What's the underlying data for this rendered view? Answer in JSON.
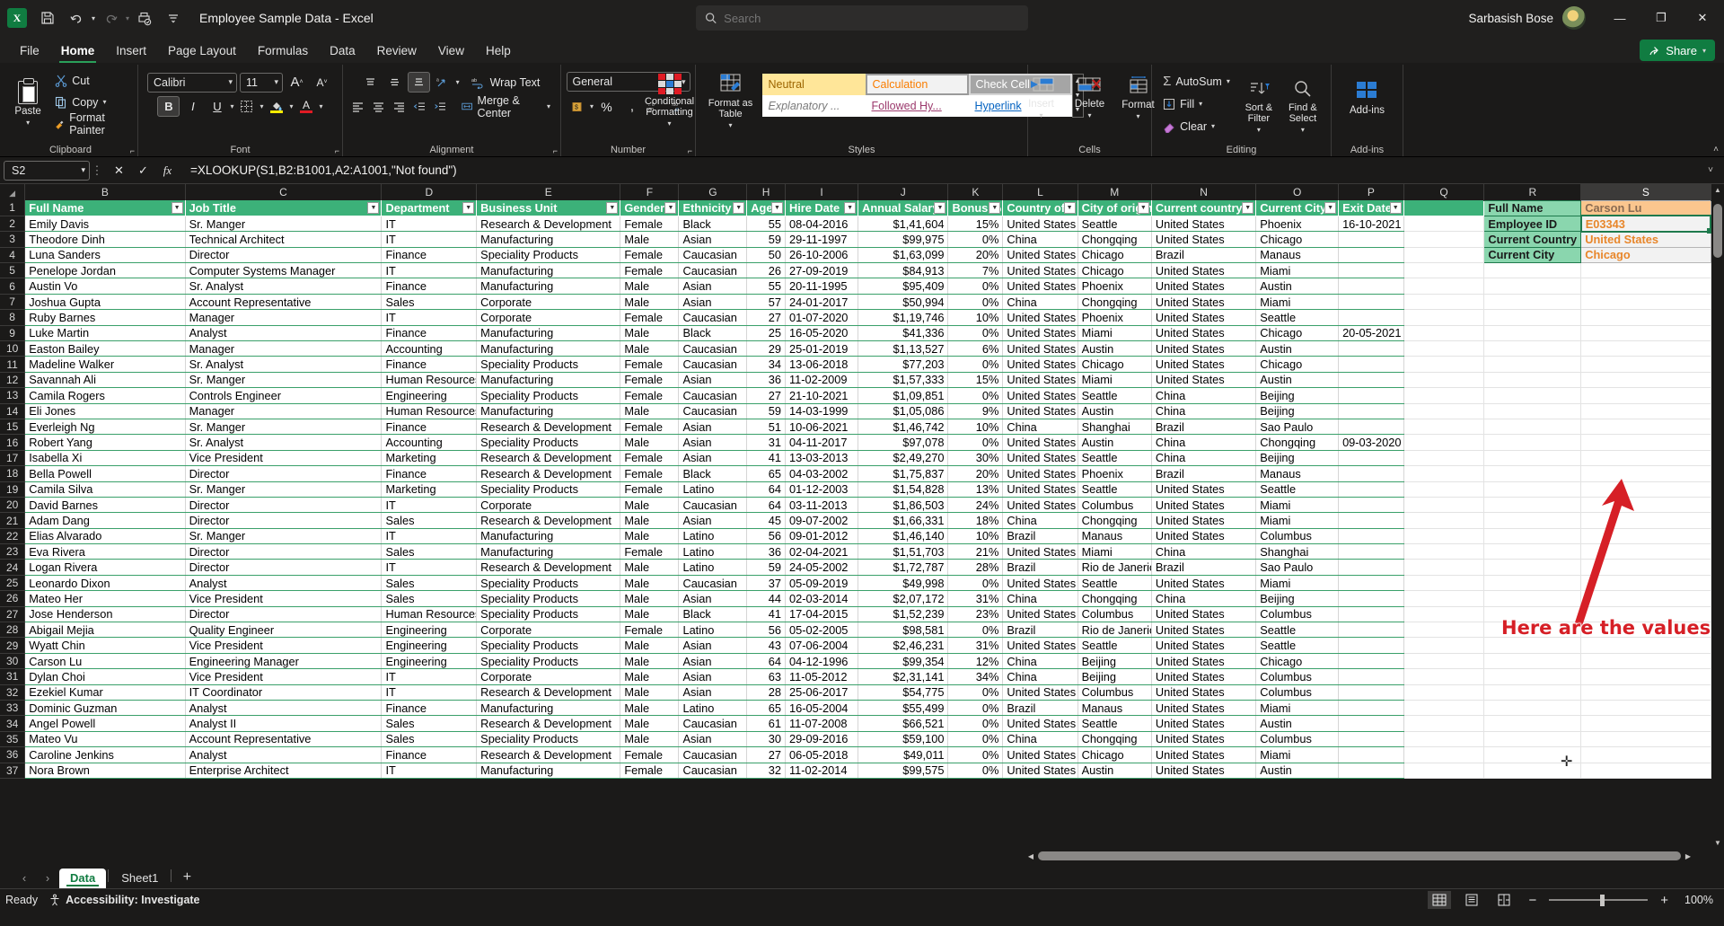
{
  "titlebar": {
    "app_icon": "excel-icon",
    "save_icon": "save-icon",
    "undo_icon": "undo-icon",
    "redo_icon": "redo-icon",
    "print_icon": "quick-print-icon",
    "customize_icon": "customize-qat-icon",
    "document_title": "Employee Sample Data  -  Excel",
    "search_placeholder": "Search",
    "user_name": "Sarbasish Bose",
    "minimize": "—",
    "restore": "❐",
    "close": "✕"
  },
  "ribbon_tabs": [
    {
      "label": "File",
      "active": false
    },
    {
      "label": "Home",
      "active": true
    },
    {
      "label": "Insert",
      "active": false
    },
    {
      "label": "Page Layout",
      "active": false
    },
    {
      "label": "Formulas",
      "active": false
    },
    {
      "label": "Data",
      "active": false
    },
    {
      "label": "Review",
      "active": false
    },
    {
      "label": "View",
      "active": false
    },
    {
      "label": "Help",
      "active": false
    }
  ],
  "share_button": "Share",
  "ribbon": {
    "clipboard": {
      "group_label": "Clipboard",
      "paste": "Paste",
      "cut": "Cut",
      "copy": "Copy",
      "format_painter": "Format Painter"
    },
    "font": {
      "group_label": "Font",
      "font_family": "Calibri",
      "font_size": "11",
      "grow_font": "A",
      "shrink_font": "A",
      "bold": "B",
      "italic": "I",
      "underline": "U",
      "borders": "borders-icon",
      "fill_color": "fill-color-icon",
      "font_color": "font-color-icon"
    },
    "alignment": {
      "group_label": "Alignment",
      "wrap_text": "Wrap Text",
      "merge_center": "Merge & Center",
      "orientation": "orientation-icon"
    },
    "number": {
      "group_label": "Number",
      "format": "General",
      "accounting": "accounting-format-icon",
      "percent": "%",
      "comma": " ,",
      "increase_decimal": ".00",
      "decrease_decimal": ".0"
    },
    "styles": {
      "group_label": "Styles",
      "conditional_formatting": "Conditional Formatting",
      "format_as_table": "Format as Table",
      "cell_styles": [
        {
          "label": "Neutral",
          "kind": "neutral"
        },
        {
          "label": "Calculation",
          "kind": "calculation"
        },
        {
          "label": "Check Cell",
          "kind": "checkcell"
        },
        {
          "label": "Explanatory ...",
          "kind": "explanatory"
        },
        {
          "label": "Followed Hy...",
          "kind": "followed"
        },
        {
          "label": "Hyperlink",
          "kind": "hyperlink"
        }
      ]
    },
    "cells": {
      "group_label": "Cells",
      "insert": "Insert",
      "delete": "Delete",
      "format": "Format"
    },
    "editing": {
      "group_label": "Editing",
      "autosum": "AutoSum",
      "fill": "Fill",
      "clear": "Clear",
      "sort_filter": "Sort & Filter",
      "find_select": "Find & Select"
    },
    "addins": {
      "group_label": "Add-ins",
      "addins": "Add-ins"
    }
  },
  "formula_bar": {
    "name_box": "S2",
    "cancel_icon": "cancel-icon",
    "enter_icon": "enter-icon",
    "fx_icon": "insert-function-icon",
    "formula": "=XLOOKUP(S1,B2:B1001,A2:A1001,\"Not found\")"
  },
  "grid": {
    "column_letters": [
      "B",
      "C",
      "D",
      "E",
      "F",
      "G",
      "H",
      "I",
      "J",
      "K",
      "L",
      "M",
      "N",
      "O",
      "P",
      "Q",
      "R",
      "S"
    ],
    "selected_column": "S",
    "headers": [
      "Full Name",
      "Job Title",
      "Department",
      "Business Unit",
      "Gender",
      "Ethnicity",
      "Age",
      "Hire Date",
      "Annual Salary",
      "Bonus %",
      "Country of o",
      "City of origin",
      "Current country",
      "Current City",
      "Exit Date"
    ],
    "row_numbers": [
      1,
      2,
      3,
      4,
      5,
      6,
      7,
      8,
      9,
      10,
      11,
      12,
      13,
      14,
      15,
      16,
      17,
      18,
      19,
      20,
      21,
      22,
      23,
      24,
      25,
      26,
      27,
      28,
      29,
      30,
      31,
      32,
      33,
      34,
      35,
      36,
      37
    ],
    "rows": [
      [
        "Emily Davis",
        "Sr. Manger",
        "IT",
        "Research & Development",
        "Female",
        "Black",
        "55",
        "08-04-2016",
        "$1,41,604",
        "15%",
        "United States",
        "Seattle",
        "United States",
        "Phoenix",
        "16-10-2021"
      ],
      [
        "Theodore Dinh",
        "Technical Architect",
        "IT",
        "Manufacturing",
        "Male",
        "Asian",
        "59",
        "29-11-1997",
        "$99,975",
        "0%",
        "China",
        "Chongqing",
        "United States",
        "Chicago",
        ""
      ],
      [
        "Luna Sanders",
        "Director",
        "Finance",
        "Speciality Products",
        "Female",
        "Caucasian",
        "50",
        "26-10-2006",
        "$1,63,099",
        "20%",
        "United States",
        "Chicago",
        "Brazil",
        "Manaus",
        ""
      ],
      [
        "Penelope Jordan",
        "Computer Systems Manager",
        "IT",
        "Manufacturing",
        "Female",
        "Caucasian",
        "26",
        "27-09-2019",
        "$84,913",
        "7%",
        "United States",
        "Chicago",
        "United States",
        "Miami",
        ""
      ],
      [
        "Austin Vo",
        "Sr. Analyst",
        "Finance",
        "Manufacturing",
        "Male",
        "Asian",
        "55",
        "20-11-1995",
        "$95,409",
        "0%",
        "United States",
        "Phoenix",
        "United States",
        "Austin",
        ""
      ],
      [
        "Joshua Gupta",
        "Account Representative",
        "Sales",
        "Corporate",
        "Male",
        "Asian",
        "57",
        "24-01-2017",
        "$50,994",
        "0%",
        "China",
        "Chongqing",
        "United States",
        "Miami",
        ""
      ],
      [
        "Ruby Barnes",
        "Manager",
        "IT",
        "Corporate",
        "Female",
        "Caucasian",
        "27",
        "01-07-2020",
        "$1,19,746",
        "10%",
        "United States",
        "Phoenix",
        "United States",
        "Seattle",
        ""
      ],
      [
        "Luke Martin",
        "Analyst",
        "Finance",
        "Manufacturing",
        "Male",
        "Black",
        "25",
        "16-05-2020",
        "$41,336",
        "0%",
        "United States",
        "Miami",
        "United States",
        "Chicago",
        "20-05-2021"
      ],
      [
        "Easton Bailey",
        "Manager",
        "Accounting",
        "Manufacturing",
        "Male",
        "Caucasian",
        "29",
        "25-01-2019",
        "$1,13,527",
        "6%",
        "United States",
        "Austin",
        "United States",
        "Austin",
        ""
      ],
      [
        "Madeline Walker",
        "Sr. Analyst",
        "Finance",
        "Speciality Products",
        "Female",
        "Caucasian",
        "34",
        "13-06-2018",
        "$77,203",
        "0%",
        "United States",
        "Chicago",
        "United States",
        "Chicago",
        ""
      ],
      [
        "Savannah Ali",
        "Sr. Manger",
        "Human Resources",
        "Manufacturing",
        "Female",
        "Asian",
        "36",
        "11-02-2009",
        "$1,57,333",
        "15%",
        "United States",
        "Miami",
        "United States",
        "Austin",
        ""
      ],
      [
        "Camila Rogers",
        "Controls Engineer",
        "Engineering",
        "Speciality Products",
        "Female",
        "Caucasian",
        "27",
        "21-10-2021",
        "$1,09,851",
        "0%",
        "United States",
        "Seattle",
        "China",
        "Beijing",
        ""
      ],
      [
        "Eli Jones",
        "Manager",
        "Human Resources",
        "Manufacturing",
        "Male",
        "Caucasian",
        "59",
        "14-03-1999",
        "$1,05,086",
        "9%",
        "United States",
        "Austin",
        "China",
        "Beijing",
        ""
      ],
      [
        "Everleigh Ng",
        "Sr. Manger",
        "Finance",
        "Research & Development",
        "Female",
        "Asian",
        "51",
        "10-06-2021",
        "$1,46,742",
        "10%",
        "China",
        "Shanghai",
        "Brazil",
        "Sao Paulo",
        ""
      ],
      [
        "Robert Yang",
        "Sr. Analyst",
        "Accounting",
        "Speciality Products",
        "Male",
        "Asian",
        "31",
        "04-11-2017",
        "$97,078",
        "0%",
        "United States",
        "Austin",
        "China",
        "Chongqing",
        "09-03-2020"
      ],
      [
        "Isabella Xi",
        "Vice President",
        "Marketing",
        "Research & Development",
        "Female",
        "Asian",
        "41",
        "13-03-2013",
        "$2,49,270",
        "30%",
        "United States",
        "Seattle",
        "China",
        "Beijing",
        ""
      ],
      [
        "Bella Powell",
        "Director",
        "Finance",
        "Research & Development",
        "Female",
        "Black",
        "65",
        "04-03-2002",
        "$1,75,837",
        "20%",
        "United States",
        "Phoenix",
        "Brazil",
        "Manaus",
        ""
      ],
      [
        "Camila Silva",
        "Sr. Manger",
        "Marketing",
        "Speciality Products",
        "Female",
        "Latino",
        "64",
        "01-12-2003",
        "$1,54,828",
        "13%",
        "United States",
        "Seattle",
        "United States",
        "Seattle",
        ""
      ],
      [
        "David Barnes",
        "Director",
        "IT",
        "Corporate",
        "Male",
        "Caucasian",
        "64",
        "03-11-2013",
        "$1,86,503",
        "24%",
        "United States",
        "Columbus",
        "United States",
        "Miami",
        ""
      ],
      [
        "Adam Dang",
        "Director",
        "Sales",
        "Research & Development",
        "Male",
        "Asian",
        "45",
        "09-07-2002",
        "$1,66,331",
        "18%",
        "China",
        "Chongqing",
        "United States",
        "Miami",
        ""
      ],
      [
        "Elias Alvarado",
        "Sr. Manger",
        "IT",
        "Manufacturing",
        "Male",
        "Latino",
        "56",
        "09-01-2012",
        "$1,46,140",
        "10%",
        "Brazil",
        "Manaus",
        "United States",
        "Columbus",
        ""
      ],
      [
        "Eva Rivera",
        "Director",
        "Sales",
        "Manufacturing",
        "Female",
        "Latino",
        "36",
        "02-04-2021",
        "$1,51,703",
        "21%",
        "United States",
        "Miami",
        "China",
        "Shanghai",
        ""
      ],
      [
        "Logan Rivera",
        "Director",
        "IT",
        "Research & Development",
        "Male",
        "Latino",
        "59",
        "24-05-2002",
        "$1,72,787",
        "28%",
        "Brazil",
        "Rio de Janerio",
        "Brazil",
        "Sao Paulo",
        ""
      ],
      [
        "Leonardo Dixon",
        "Analyst",
        "Sales",
        "Speciality Products",
        "Male",
        "Caucasian",
        "37",
        "05-09-2019",
        "$49,998",
        "0%",
        "United States",
        "Seattle",
        "United States",
        "Miami",
        ""
      ],
      [
        "Mateo Her",
        "Vice President",
        "Sales",
        "Speciality Products",
        "Male",
        "Asian",
        "44",
        "02-03-2014",
        "$2,07,172",
        "31%",
        "China",
        "Chongqing",
        "China",
        "Beijing",
        ""
      ],
      [
        "Jose Henderson",
        "Director",
        "Human Resources",
        "Speciality Products",
        "Male",
        "Black",
        "41",
        "17-04-2015",
        "$1,52,239",
        "23%",
        "United States",
        "Columbus",
        "United States",
        "Columbus",
        ""
      ],
      [
        "Abigail Mejia",
        "Quality Engineer",
        "Engineering",
        "Corporate",
        "Female",
        "Latino",
        "56",
        "05-02-2005",
        "$98,581",
        "0%",
        "Brazil",
        "Rio de Janerio",
        "United States",
        "Seattle",
        ""
      ],
      [
        "Wyatt Chin",
        "Vice President",
        "Engineering",
        "Speciality Products",
        "Male",
        "Asian",
        "43",
        "07-06-2004",
        "$2,46,231",
        "31%",
        "United States",
        "Seattle",
        "United States",
        "Seattle",
        ""
      ],
      [
        "Carson Lu",
        "Engineering Manager",
        "Engineering",
        "Speciality Products",
        "Male",
        "Asian",
        "64",
        "04-12-1996",
        "$99,354",
        "12%",
        "China",
        "Beijing",
        "United States",
        "Chicago",
        ""
      ],
      [
        "Dylan Choi",
        "Vice President",
        "IT",
        "Corporate",
        "Male",
        "Asian",
        "63",
        "11-05-2012",
        "$2,31,141",
        "34%",
        "China",
        "Beijing",
        "United States",
        "Columbus",
        ""
      ],
      [
        "Ezekiel Kumar",
        "IT Coordinator",
        "IT",
        "Research & Development",
        "Male",
        "Asian",
        "28",
        "25-06-2017",
        "$54,775",
        "0%",
        "United States",
        "Columbus",
        "United States",
        "Columbus",
        ""
      ],
      [
        "Dominic Guzman",
        "Analyst",
        "Finance",
        "Manufacturing",
        "Male",
        "Latino",
        "65",
        "16-05-2004",
        "$55,499",
        "0%",
        "Brazil",
        "Manaus",
        "United States",
        "Miami",
        ""
      ],
      [
        "Angel Powell",
        "Analyst II",
        "Sales",
        "Research & Development",
        "Male",
        "Caucasian",
        "61",
        "11-07-2008",
        "$66,521",
        "0%",
        "United States",
        "Seattle",
        "United States",
        "Austin",
        ""
      ],
      [
        "Mateo Vu",
        "Account Representative",
        "Sales",
        "Speciality Products",
        "Male",
        "Asian",
        "30",
        "29-09-2016",
        "$59,100",
        "0%",
        "China",
        "Chongqing",
        "United States",
        "Columbus",
        ""
      ],
      [
        "Caroline Jenkins",
        "Analyst",
        "Finance",
        "Research & Development",
        "Female",
        "Caucasian",
        "27",
        "06-05-2018",
        "$49,011",
        "0%",
        "United States",
        "Chicago",
        "United States",
        "Miami",
        ""
      ],
      [
        "Nora Brown",
        "Enterprise Architect",
        "IT",
        "Manufacturing",
        "Female",
        "Caucasian",
        "32",
        "11-02-2014",
        "$99,575",
        "0%",
        "United States",
        "Austin",
        "United States",
        "Austin",
        ""
      ]
    ]
  },
  "lookup_panel": {
    "rows": [
      {
        "label": "Full Name",
        "value": "Carson Lu",
        "style": "highlight"
      },
      {
        "label": "Employee ID",
        "value": "E03343",
        "style": "active"
      },
      {
        "label": "Current Country",
        "value": "United States",
        "style": "normal"
      },
      {
        "label": "Current City",
        "value": "Chicago",
        "style": "normal"
      }
    ]
  },
  "annotation": {
    "text": "Here are the values",
    "color": "#d61f26",
    "arrow": "red-arrow-annotation"
  },
  "sheet_tabs": {
    "prev_icon": "previous-sheet-icon",
    "next_icon": "next-sheet-icon",
    "tabs": [
      {
        "label": "Data",
        "active": true
      },
      {
        "label": "Sheet1",
        "active": false
      }
    ],
    "add_sheet": "+"
  },
  "status_bar": {
    "state": "Ready",
    "accessibility": "Accessibility: Investigate",
    "views": [
      "normal-view-icon",
      "page-layout-icon",
      "page-break-preview-icon"
    ],
    "zoom_out": "−",
    "zoom_in": "+",
    "zoom_level": "100%"
  },
  "colors": {
    "excel_green": "#107c41",
    "table_header": "#3cb179",
    "lookup_label": "#8ad6ae",
    "lookup_value_text": "#e8862a",
    "annotation_red": "#d61f26"
  }
}
